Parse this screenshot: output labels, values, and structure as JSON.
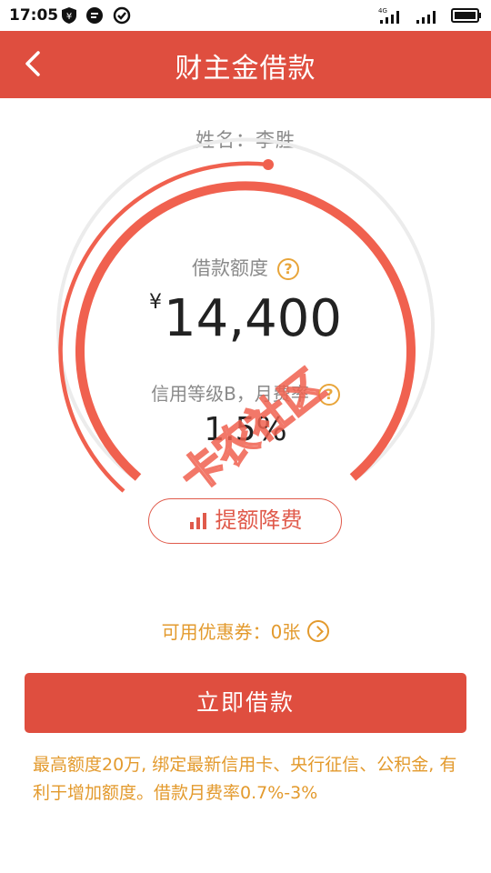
{
  "status_bar": {
    "time": "17:05",
    "left_icons": [
      "shield-yen-icon",
      "message-icon",
      "check-circle-icon"
    ],
    "right_icons": [
      "signal-4g-icon",
      "signal-icon",
      "battery-icon"
    ]
  },
  "header": {
    "title": "财主金借款",
    "back_icon": "chevron-left-icon"
  },
  "borrower": {
    "name_line": "姓名：李胜"
  },
  "gauge": {
    "accent_color": "#f0614f",
    "track_color": "#eeeeee"
  },
  "loan": {
    "label": "借款额度",
    "help_icon": "question-icon",
    "currency": "¥",
    "amount": "14,400",
    "rate_label": "信用等级B，月费率",
    "rate": "1.5%"
  },
  "raise_button": {
    "label": "提额降费",
    "icon": "bar-chart-icon"
  },
  "coupon": {
    "text": "可用优惠券：0张",
    "arrow_icon": "chevron-right-circle-icon"
  },
  "borrow_button": {
    "label": "立即借款"
  },
  "note": {
    "text": "最高额度20万, 绑定最新信用卡、央行征信、公积金, 有利于增加额度。借款月费率0.7%-3%"
  },
  "watermark": {
    "text": "卡农社区",
    "color": "#f0614f"
  }
}
